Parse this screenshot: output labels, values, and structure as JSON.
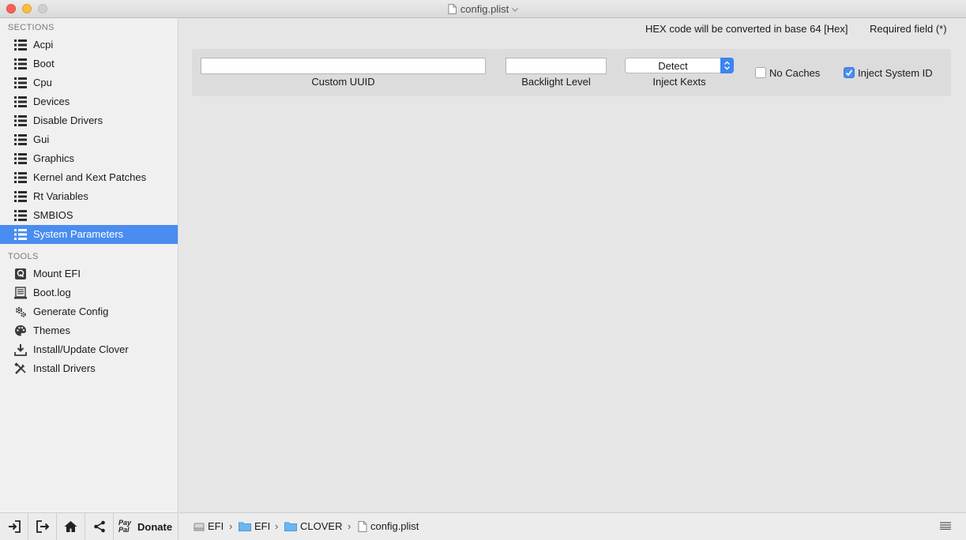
{
  "window": {
    "title": "config.plist"
  },
  "sidebar": {
    "sections_header": "SECTIONS",
    "sections": [
      {
        "label": "Acpi"
      },
      {
        "label": "Boot"
      },
      {
        "label": "Cpu"
      },
      {
        "label": "Devices"
      },
      {
        "label": "Disable Drivers"
      },
      {
        "label": "Gui"
      },
      {
        "label": "Graphics"
      },
      {
        "label": "Kernel and Kext Patches"
      },
      {
        "label": "Rt Variables"
      },
      {
        "label": "SMBIOS"
      },
      {
        "label": "System Parameters",
        "selected": true
      }
    ],
    "tools_header": "TOOLS",
    "tools": [
      {
        "label": "Mount EFI",
        "icon": "disk-icon"
      },
      {
        "label": "Boot.log",
        "icon": "log-icon"
      },
      {
        "label": "Generate Config",
        "icon": "gears-icon"
      },
      {
        "label": "Themes",
        "icon": "palette-icon"
      },
      {
        "label": "Install/Update Clover",
        "icon": "download-icon"
      },
      {
        "label": "Install Drivers",
        "icon": "tools-icon"
      }
    ]
  },
  "bottom_left": {
    "paypal_text_1": "Pay",
    "paypal_text_2": "Pal",
    "donate_label": "Donate"
  },
  "main": {
    "hex_note": "HEX code will be converted in base 64 [Hex]",
    "required_note": "Required field (*)",
    "custom_uuid": {
      "label": "Custom UUID",
      "value": ""
    },
    "backlight_level": {
      "label": "Backlight Level",
      "value": ""
    },
    "inject_kexts": {
      "label": "Inject Kexts",
      "value": "Detect"
    },
    "no_caches": {
      "label": "No Caches",
      "checked": false
    },
    "inject_system_id": {
      "label": "Inject System ID",
      "checked": true
    }
  },
  "pathbar": {
    "items": [
      "EFI",
      "EFI",
      "CLOVER",
      "config.plist"
    ],
    "separator": "›"
  },
  "colors": {
    "accent": "#4a8cf0",
    "folder": "#6cb6f0"
  }
}
